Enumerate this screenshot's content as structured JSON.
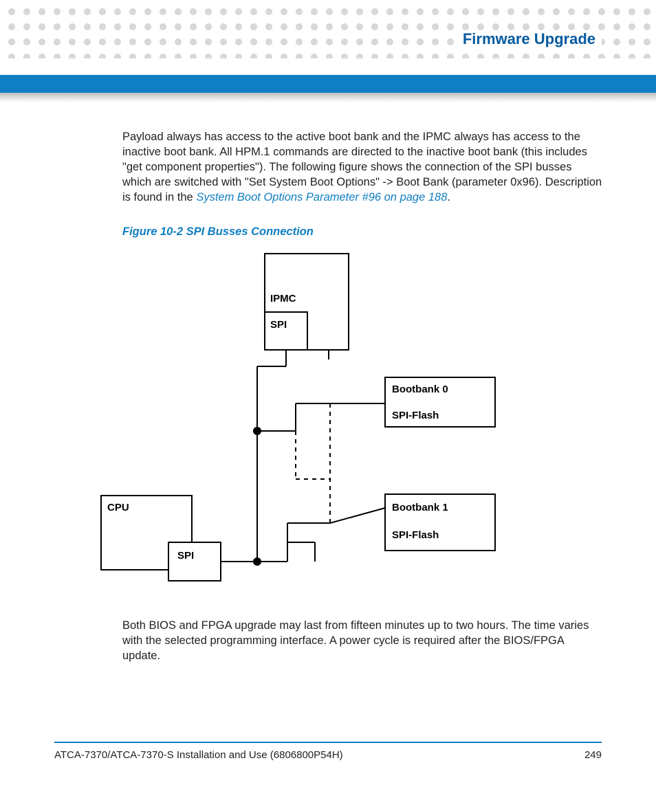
{
  "header": {
    "title": "Firmware Upgrade"
  },
  "body": {
    "para1_a": "Payload always has access to the active boot bank and the IPMC always has access to the inactive boot bank. All HPM.1 commands are directed to the inactive boot bank (this includes \"get component properties\"). The following figure shows the connection of the SPI busses which are switched with \"Set System Boot Options\" -> Boot Bank (parameter 0x96). Description is found in the ",
    "para1_link": "System Boot Options Parameter #96 on page 188",
    "para1_b": ".",
    "figure_caption": "Figure 10-2     SPI Busses Connection",
    "para2": "Both BIOS and FPGA upgrade may last from fifteen minutes up to two hours. The time varies with the selected programming interface. A power cycle is required after the BIOS/FPGA update."
  },
  "diagram": {
    "ipmc": "IPMC",
    "spi_ipmc": "SPI",
    "bootbank0": "Bootbank 0",
    "spiflash0": "SPI-Flash",
    "bootbank1": "Bootbank 1",
    "spiflash1": "SPI-Flash",
    "cpu": "CPU",
    "spi_cpu": "SPI"
  },
  "footer": {
    "doc": "ATCA-7370/ATCA-7370-S Installation and Use (6806800P54H)",
    "page": "249"
  }
}
